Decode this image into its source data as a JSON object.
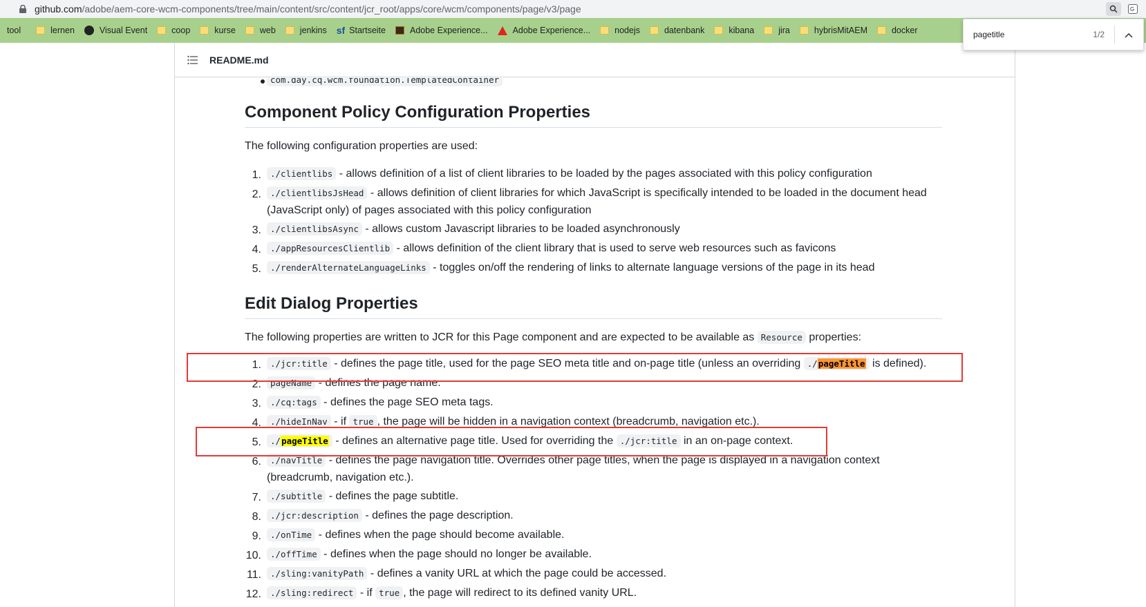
{
  "address_bar": {
    "host": "github.com",
    "path": "/adobe/aem-core-wcm-components/tree/main/content/src/content/jcr_root/apps/core/wcm/components/page/v3/page"
  },
  "bookmarks": [
    {
      "label": "tool",
      "icon": "folder-icon"
    },
    {
      "label": "lernen",
      "icon": "folder-icon"
    },
    {
      "label": "Visual Event",
      "icon": "globe-icon"
    },
    {
      "label": "coop",
      "icon": "folder-icon"
    },
    {
      "label": "kurse",
      "icon": "folder-icon"
    },
    {
      "label": "web",
      "icon": "folder-icon"
    },
    {
      "label": "jenkins",
      "icon": "folder-icon"
    },
    {
      "label": "Startseite",
      "icon": "sf-icon"
    },
    {
      "label": "Adobe Experience...",
      "icon": "adobe-ai-icon"
    },
    {
      "label": "Adobe Experience...",
      "icon": "adobe-logo-icon"
    },
    {
      "label": "nodejs",
      "icon": "folder-icon"
    },
    {
      "label": "datenbank",
      "icon": "folder-icon"
    },
    {
      "label": "kibana",
      "icon": "folder-icon"
    },
    {
      "label": "jira",
      "icon": "folder-icon"
    },
    {
      "label": "hybrisMitAEM",
      "icon": "folder-icon"
    },
    {
      "label": "docker",
      "icon": "folder-icon"
    }
  ],
  "find_bar": {
    "query": "pagetitle",
    "count": "1/2"
  },
  "readme": {
    "title": "README.md",
    "top_item_code": "com.day.cq.wcm.foundation.TemplatedContainer",
    "section1": {
      "heading": "Component Policy Configuration Properties",
      "intro": "The following configuration properties are used:",
      "items": [
        {
          "num": "1.",
          "code": "./clientlibs",
          "text": " - allows definition of a list of client libraries to be loaded by the pages associated with this policy configuration"
        },
        {
          "num": "2.",
          "code": "./clientlibsJsHead",
          "text": " - allows definition of client libraries for which JavaScript is specifically intended to be loaded in the document head",
          "text2": "(JavaScript only) of pages associated with this policy configuration"
        },
        {
          "num": "3.",
          "code": "./clientlibsAsync",
          "text": " - allows custom Javascript libraries to be loaded asynchronously"
        },
        {
          "num": "4.",
          "code": "./appResourcesClientlib",
          "text": " - allows definition of the client library that is used to serve web resources such as favicons"
        },
        {
          "num": "5.",
          "code": "./renderAlternateLanguageLinks",
          "text": " - toggles on/off the rendering of links to alternate language versions of the page in its head"
        }
      ]
    },
    "section2": {
      "heading": "Edit Dialog Properties",
      "intro_before": "The following properties are written to JCR for this Page component and are expected to be available as ",
      "intro_code": "Resource",
      "intro_after": " properties:",
      "item1": {
        "num": "1.",
        "code": "./jcr:title",
        "text": " - defines the page title, used for the page SEO meta title and on-page title (unless an overriding ",
        "code2_prefix": "./",
        "code2_hl": "pageTitle",
        "text_after": " is defined)."
      },
      "item2": {
        "num": "2.",
        "code": "pageName",
        "text": " - defines the page name."
      },
      "item3": {
        "num": "3.",
        "code": "./cq:tags",
        "text": " - defines the page SEO meta tags."
      },
      "item4": {
        "num": "4.",
        "code": "./hideInNav",
        "text": " - if ",
        "code2": "true",
        "text_after": ", the page will be hidden in a navigation context (breadcrumb, navigation etc.)."
      },
      "item5": {
        "num": "5.",
        "code_prefix": "./",
        "code_hl": "pageTitle",
        "text": " - defines an alternative page title. Used for overriding the ",
        "code2": "./jcr:title",
        "text_after": " in an on-page context."
      },
      "item6": {
        "num": "6.",
        "code": "./navTitle",
        "text": " - defines the page navigation title. Overrides other page titles, when the page is displayed in a navigation context",
        "text2": "(breadcrumb, navigation etc.)."
      },
      "item7": {
        "num": "7.",
        "code": "./subtitle",
        "text": " - defines the page subtitle."
      },
      "item8": {
        "num": "8.",
        "code": "./jcr:description",
        "text": " - defines the page description."
      },
      "item9": {
        "num": "9.",
        "code": "./onTime",
        "text": " - defines when the page should become available."
      },
      "item10": {
        "num": "10.",
        "code": "./offTime",
        "text": " - defines when the page should no longer be available."
      },
      "item11": {
        "num": "11.",
        "code": "./sling:vanityPath",
        "text": " - defines a vanity URL at which the page could be accessed."
      },
      "item12": {
        "num": "12.",
        "code": "./sling:redirect",
        "text": " - if ",
        "code2": "true",
        "text_after": ", the page will redirect to its defined vanity URL."
      }
    }
  }
}
